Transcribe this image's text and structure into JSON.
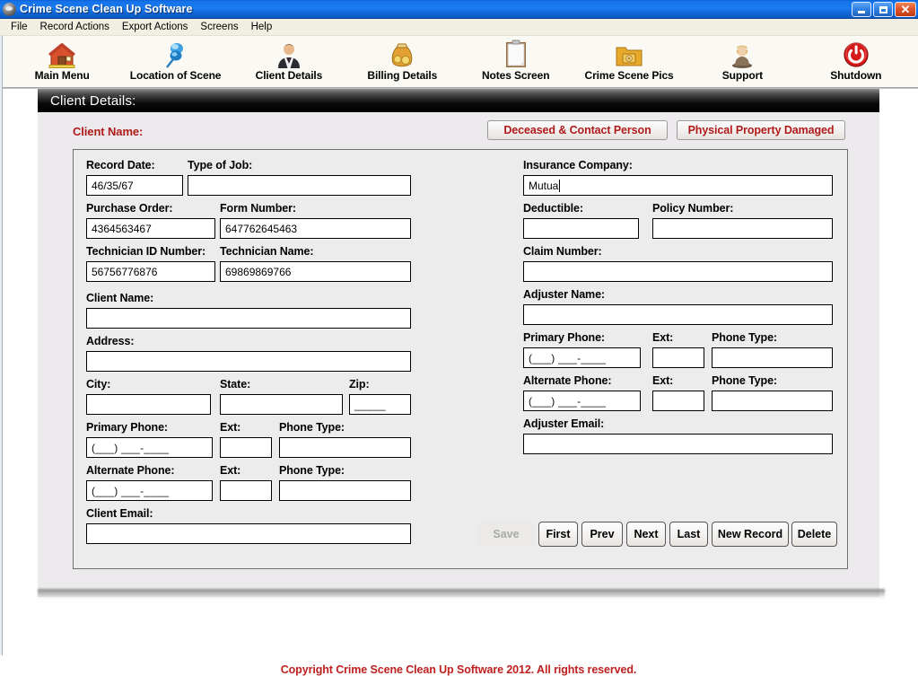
{
  "window": {
    "title": "Crime Scene Clean Up Software",
    "icon": "app-globe-icon",
    "minimize": "minimize-icon",
    "maximize": "maximize-icon",
    "close": "close-icon",
    "close_glyph": "✕"
  },
  "menubar": {
    "items": [
      {
        "label": "File"
      },
      {
        "label": "Record Actions"
      },
      {
        "label": "Export Actions"
      },
      {
        "label": "Screens"
      },
      {
        "label": "Help"
      }
    ]
  },
  "toolbar": {
    "items": [
      {
        "label": "Main Menu",
        "icon": "house-icon"
      },
      {
        "label": "Location of Scene",
        "icon": "map-pin-icon"
      },
      {
        "label": "Client Details",
        "icon": "businessman-icon"
      },
      {
        "label": "Billing Details",
        "icon": "money-bag-icon"
      },
      {
        "label": "Notes Screen",
        "icon": "clipboard-icon"
      },
      {
        "label": "Crime Scene Pics",
        "icon": "photo-folder-icon"
      },
      {
        "label": "Support",
        "icon": "support-person-icon"
      },
      {
        "label": "Shutdown",
        "icon": "power-icon"
      }
    ]
  },
  "section": {
    "title": "Client Details:",
    "client_name_label": "Client Name:"
  },
  "top_buttons": {
    "deceased": "Deceased & Contact Person",
    "property": "Physical Property Damaged"
  },
  "form": {
    "left": {
      "record_date": {
        "label": "Record Date:",
        "value": "46/35/67"
      },
      "type_of_job": {
        "label": "Type of Job:",
        "value": ""
      },
      "purchase_order": {
        "label": "Purchase Order:",
        "value": "4364563467"
      },
      "form_number": {
        "label": "Form Number:",
        "value": "647762645463"
      },
      "technician_id": {
        "label": "Technician ID Number:",
        "value": "56756776876"
      },
      "technician_name": {
        "label": "Technician Name:",
        "value": "69869869766"
      },
      "client_name": {
        "label": "Client Name:",
        "value": ""
      },
      "address": {
        "label": "Address:",
        "value": ""
      },
      "city": {
        "label": "City:",
        "value": ""
      },
      "state": {
        "label": "State:",
        "value": ""
      },
      "zip": {
        "label": "Zip:",
        "value": "_____"
      },
      "primary_phone": {
        "label": "Primary Phone:",
        "value": "(___) ___-____"
      },
      "primary_ext": {
        "label": "Ext:",
        "value": ""
      },
      "primary_phone_type": {
        "label": "Phone Type:",
        "value": ""
      },
      "alternate_phone": {
        "label": "Alternate Phone:",
        "value": "(___) ___-____"
      },
      "alternate_ext": {
        "label": "Ext:",
        "value": ""
      },
      "alternate_phone_type": {
        "label": "Phone Type:",
        "value": ""
      },
      "client_email": {
        "label": "Client Email:",
        "value": ""
      }
    },
    "right": {
      "insurance_company": {
        "label": "Insurance Company:",
        "value": "Mutua",
        "focused": true
      },
      "deductible": {
        "label": "Deductible:",
        "value": ""
      },
      "policy_number": {
        "label": "Policy Number:",
        "value": ""
      },
      "claim_number": {
        "label": "Claim Number:",
        "value": ""
      },
      "adjuster_name": {
        "label": "Adjuster Name:",
        "value": ""
      },
      "adj_primary_phone": {
        "label": "Primary Phone:",
        "value": "(___) ___-____"
      },
      "adj_primary_ext": {
        "label": "Ext:",
        "value": ""
      },
      "adj_primary_phone_type": {
        "label": "Phone Type:",
        "value": ""
      },
      "adj_alternate_phone": {
        "label": "Alternate Phone:",
        "value": "(___) ___-____"
      },
      "adj_alternate_ext": {
        "label": "Ext:",
        "value": ""
      },
      "adj_alternate_phone_type": {
        "label": "Phone Type:",
        "value": ""
      },
      "adjuster_email": {
        "label": "Adjuster Email:",
        "value": ""
      }
    }
  },
  "nav_buttons": {
    "save": {
      "label": "Save",
      "enabled": false
    },
    "first": {
      "label": "First",
      "enabled": true
    },
    "prev": {
      "label": "Prev",
      "enabled": true
    },
    "next": {
      "label": "Next",
      "enabled": true
    },
    "last": {
      "label": "Last",
      "enabled": true
    },
    "new_record": {
      "label": "New Record",
      "enabled": true
    },
    "delete": {
      "label": "Delete",
      "enabled": true
    }
  },
  "footer": {
    "copyright": "Copyright Crime Scene Clean Up Software 2012. All rights reserved."
  },
  "colors": {
    "titlebar_blue": "#1a7bf0",
    "accent_red": "#b01a1a",
    "footer_red": "#c01f1f",
    "panel_bg": "#eceaec",
    "header_black": "#000000"
  }
}
